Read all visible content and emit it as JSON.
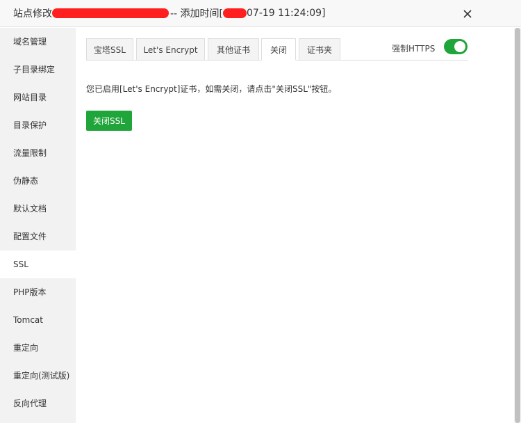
{
  "titlebar": {
    "prefix": "站点修改",
    "mid": " -- 添加时间[",
    "suffix": "07-19 11:24:09]"
  },
  "sidebar": {
    "items": [
      {
        "label": "域名管理"
      },
      {
        "label": "子目录绑定"
      },
      {
        "label": "网站目录"
      },
      {
        "label": "目录保护"
      },
      {
        "label": "流量限制"
      },
      {
        "label": "伪静态"
      },
      {
        "label": "默认文档"
      },
      {
        "label": "配置文件"
      },
      {
        "label": "SSL"
      },
      {
        "label": "PHP版本"
      },
      {
        "label": "Tomcat"
      },
      {
        "label": "重定向"
      },
      {
        "label": "重定向(测试版)"
      },
      {
        "label": "反向代理"
      }
    ],
    "active": "SSL"
  },
  "tabs": [
    {
      "label": "宝塔SSL"
    },
    {
      "label": "Let's Encrypt"
    },
    {
      "label": "其他证书"
    },
    {
      "label": "关闭"
    },
    {
      "label": "证书夹"
    }
  ],
  "active_tab": "关闭",
  "force_https": {
    "label": "强制HTTPS",
    "enabled": true
  },
  "content": {
    "message": "您已启用[Let's Encrypt]证书，如需关闭，请点击\"关闭SSL\"按钮。",
    "close_button": "关闭SSL"
  },
  "colors": {
    "accent": "#20a53a",
    "redaction": "#ff1f1f"
  },
  "icons": {
    "close": "close-icon"
  }
}
